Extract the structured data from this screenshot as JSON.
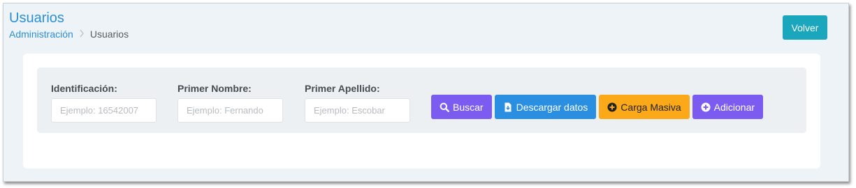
{
  "header": {
    "title": "Usuarios",
    "breadcrumb": [
      {
        "label": "Administración"
      },
      {
        "label": "Usuarios"
      }
    ],
    "back_button": "Volver"
  },
  "filters": {
    "identificacion": {
      "label": "Identificación:",
      "placeholder": "Ejemplo: 16542007",
      "value": ""
    },
    "primer_nombre": {
      "label": "Primer Nombre:",
      "placeholder": "Ejemplo: Fernando",
      "value": ""
    },
    "primer_apellido": {
      "label": "Primer Apellido:",
      "placeholder": "Ejemplo: Escobar",
      "value": ""
    }
  },
  "actions": {
    "search": {
      "label": "Buscar",
      "icon": "search-icon"
    },
    "download": {
      "label": "Descargar datos",
      "icon": "file-download-icon"
    },
    "bulk_upload": {
      "label": "Carga Masiva",
      "icon": "plus-circle-icon"
    },
    "add": {
      "label": "Adicionar",
      "icon": "plus-circle-icon"
    }
  },
  "colors": {
    "accent": "#2b8fd6",
    "back_button": "#1aa7bd",
    "purple": "#7c5cf0",
    "blue": "#2a8fe0",
    "orange": "#fba919"
  }
}
